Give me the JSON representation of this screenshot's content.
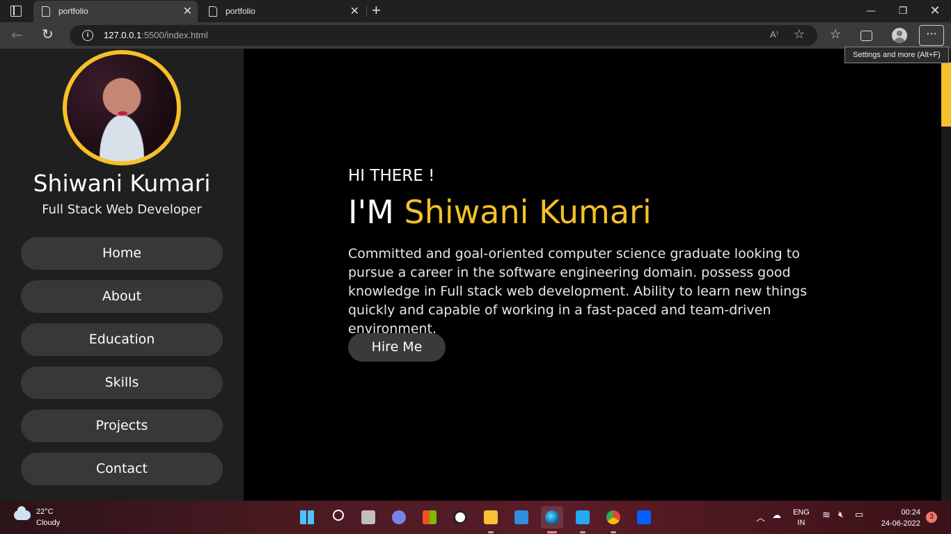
{
  "browser": {
    "tabs": [
      {
        "title": "portfolio",
        "active": true
      },
      {
        "title": "portfolio",
        "active": false
      }
    ],
    "url_host": "127.0.0.1",
    "url_path": ":5500/index.html",
    "tooltip": "Settings and more (Alt+F)",
    "read_aloud_label": "A⁾"
  },
  "sidebar": {
    "name": "Shiwani Kumari",
    "role": "Full Stack Web Developer",
    "nav": [
      "Home",
      "About",
      "Education",
      "Skills",
      "Projects",
      "Contact"
    ]
  },
  "hero": {
    "greeting": "HI THERE !",
    "im_prefix": "I'M",
    "name": "Shiwani Kumari",
    "intro": "Committed and goal-oriented computer science graduate looking to pursue a career in the software engineering domain. possess good knowledge in Full stack web development. Ability to learn new things quickly and capable of working in a fast-paced and team-driven environment.",
    "hire_button": "Hire Me"
  },
  "taskbar": {
    "weather_temp": "22°C",
    "weather_condition": "Cloudy",
    "lang_top": "ENG",
    "lang_bottom": "IN",
    "time": "00:24",
    "date": "24-06-2022",
    "notifications": "3"
  },
  "colors": {
    "accent": "#f5c029",
    "sidebar_bg": "#1f1f1f",
    "button_bg": "#383838"
  }
}
